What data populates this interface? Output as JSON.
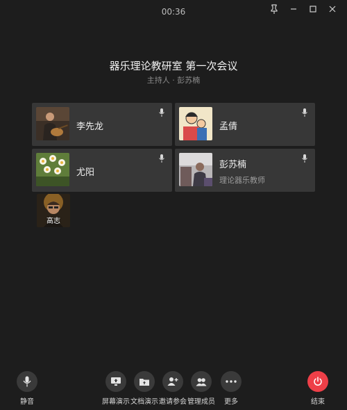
{
  "titlebar": {
    "timer": "00:36"
  },
  "meeting": {
    "title": "器乐理论教研室 第一次会议",
    "host": "主持人 · 彭苏楠"
  },
  "participants": [
    {
      "name": "李先龙",
      "role": ""
    },
    {
      "name": "孟倩",
      "role": ""
    },
    {
      "name": "尤阳",
      "role": ""
    },
    {
      "name": "彭苏楠",
      "role": "理论器乐教师"
    }
  ],
  "solo": {
    "name": "高志"
  },
  "toolbar": {
    "mute": "静音",
    "screen_share": "屏幕演示",
    "doc_share": "文档演示",
    "invite": "邀请参会",
    "manage": "管理成员",
    "more": "更多",
    "end": "结束"
  },
  "colors": {
    "background": "#1d1d1d",
    "card": "#373737",
    "end_button": "#ee3f48"
  }
}
